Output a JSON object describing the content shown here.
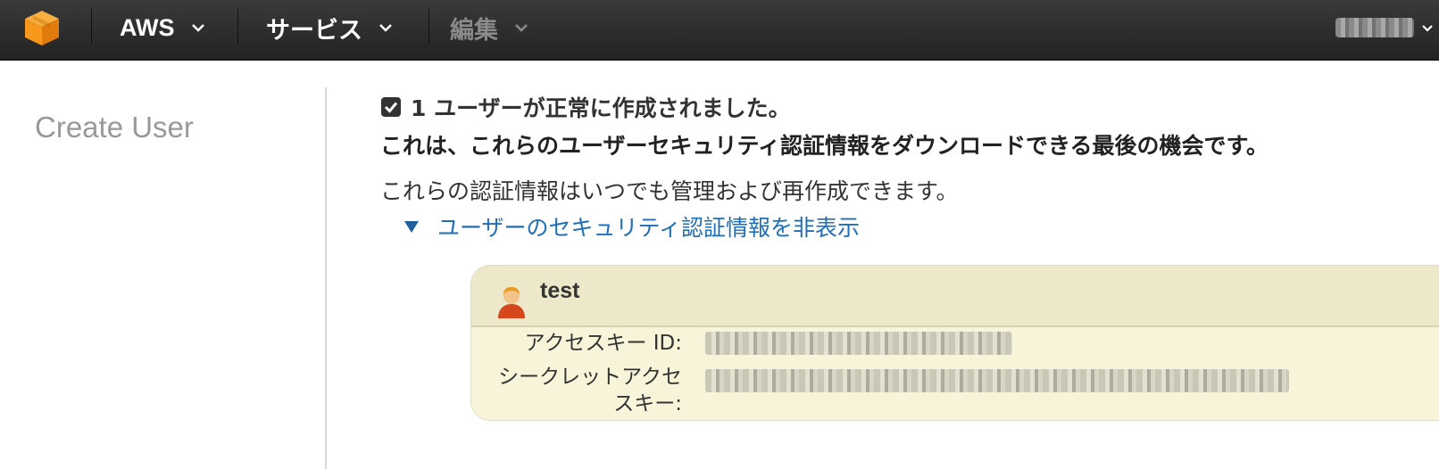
{
  "topbar": {
    "logo_icon": "aws-cube-icon",
    "nav": [
      {
        "label": "AWS",
        "enabled": true
      },
      {
        "label": "サービス",
        "enabled": true
      },
      {
        "label": "編集",
        "enabled": false
      }
    ],
    "user_menu": {
      "label_visible": false
    }
  },
  "sidebar": {
    "title": "Create User"
  },
  "main": {
    "success_message": "1 ユーザーが正常に作成されました。",
    "warning_message": "これは、これらのユーザーセキュリティ認証情報をダウンロードできる最後の機会です。",
    "info_message": "これらの認証情報はいつでも管理および再作成できます。",
    "toggle_label": "ユーザーのセキュリティ認証情報を非表示",
    "credentials": {
      "username": "test",
      "access_key_label": "アクセスキー ID:",
      "secret_key_label_line1": "シークレットアクセ",
      "secret_key_label_line2": "スキー:"
    }
  },
  "colors": {
    "topbar_bg": "#2b2b2b",
    "link": "#1e6fb8",
    "panel_bg": "#f7f4d9",
    "panel_header_bg": "#ece8c9",
    "logo_orange": "#f7981d"
  }
}
